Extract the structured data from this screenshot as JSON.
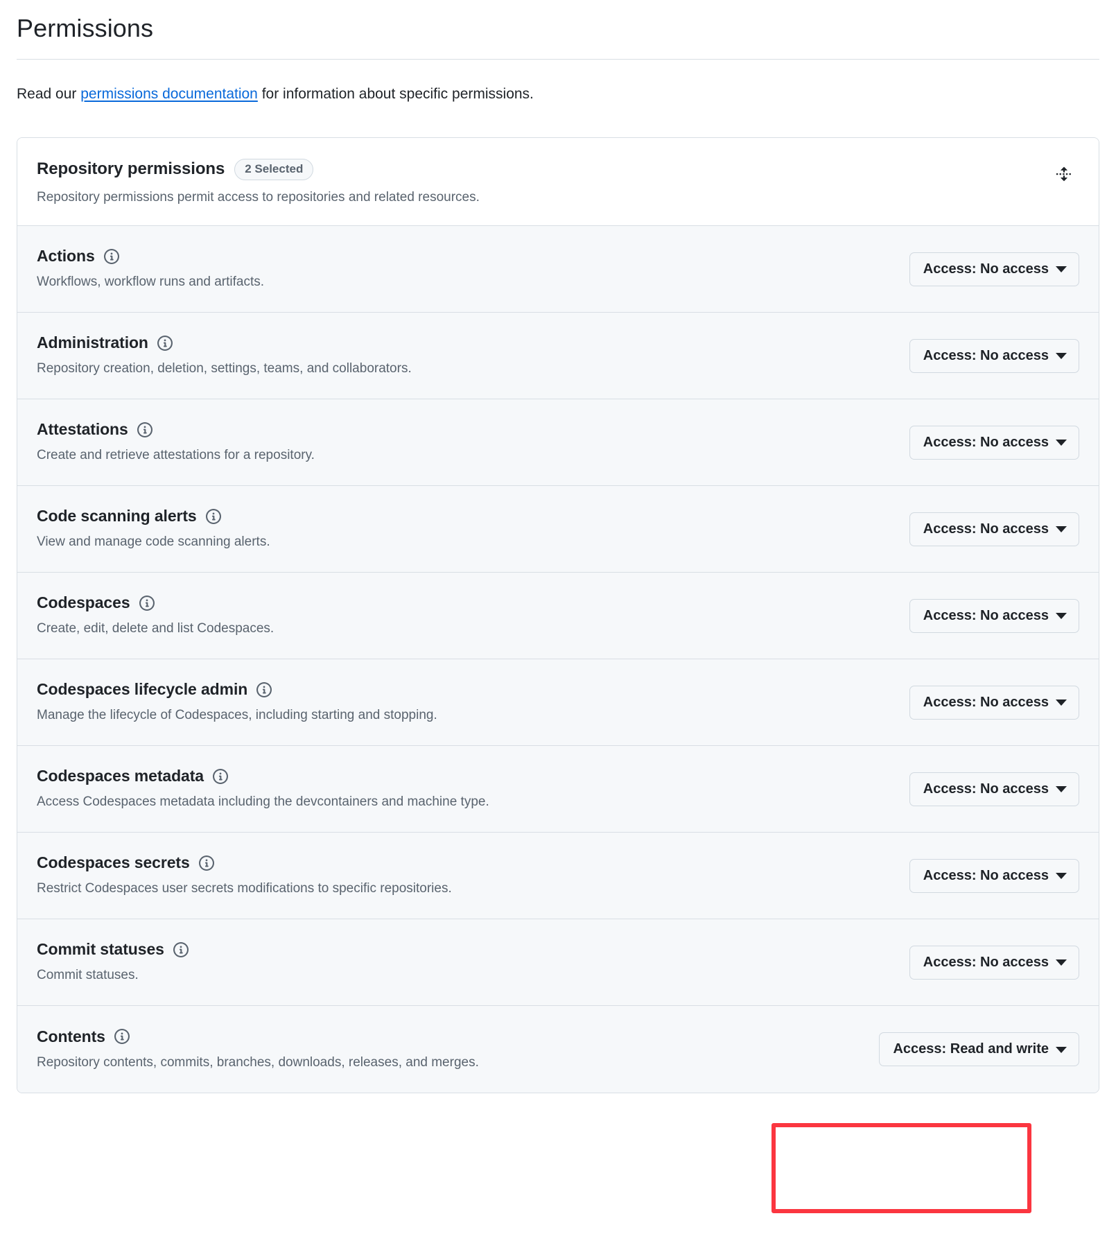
{
  "header": {
    "title": "Permissions",
    "intro_before": "Read our ",
    "intro_link": "permissions documentation",
    "intro_after": " for information about specific permissions."
  },
  "card": {
    "title": "Repository permissions",
    "badge": "2 Selected",
    "subtitle": "Repository permissions permit access to repositories and related resources.",
    "collapse_icon": "fold-icon"
  },
  "permissions": [
    {
      "name": "Actions",
      "description": "Workflows, workflow runs and artifacts.",
      "access": "Access: No access",
      "info_icon": "info-icon"
    },
    {
      "name": "Administration",
      "description": "Repository creation, deletion, settings, teams, and collaborators.",
      "access": "Access: No access",
      "info_icon": "info-icon"
    },
    {
      "name": "Attestations",
      "description": "Create and retrieve attestations for a repository.",
      "access": "Access: No access",
      "info_icon": "info-icon"
    },
    {
      "name": "Code scanning alerts",
      "description": "View and manage code scanning alerts.",
      "access": "Access: No access",
      "info_icon": "info-icon"
    },
    {
      "name": "Codespaces",
      "description": "Create, edit, delete and list Codespaces.",
      "access": "Access: No access",
      "info_icon": "info-icon"
    },
    {
      "name": "Codespaces lifecycle admin",
      "description": "Manage the lifecycle of Codespaces, including starting and stopping.",
      "access": "Access: No access",
      "info_icon": "info-icon"
    },
    {
      "name": "Codespaces metadata",
      "description": "Access Codespaces metadata including the devcontainers and machine type.",
      "access": "Access: No access",
      "info_icon": "info-icon"
    },
    {
      "name": "Codespaces secrets",
      "description": "Restrict Codespaces user secrets modifications to specific repositories.",
      "access": "Access: No access",
      "info_icon": "info-icon"
    },
    {
      "name": "Commit statuses",
      "description": "Commit statuses.",
      "access": "Access: No access",
      "info_icon": "info-icon"
    },
    {
      "name": "Contents",
      "description": "Repository contents, commits, branches, downloads, releases, and merges.",
      "access": "Access: Read and write",
      "info_icon": "info-icon"
    }
  ],
  "annotation": {
    "color": "#fb3640",
    "target": "contents-access-dropdown"
  }
}
